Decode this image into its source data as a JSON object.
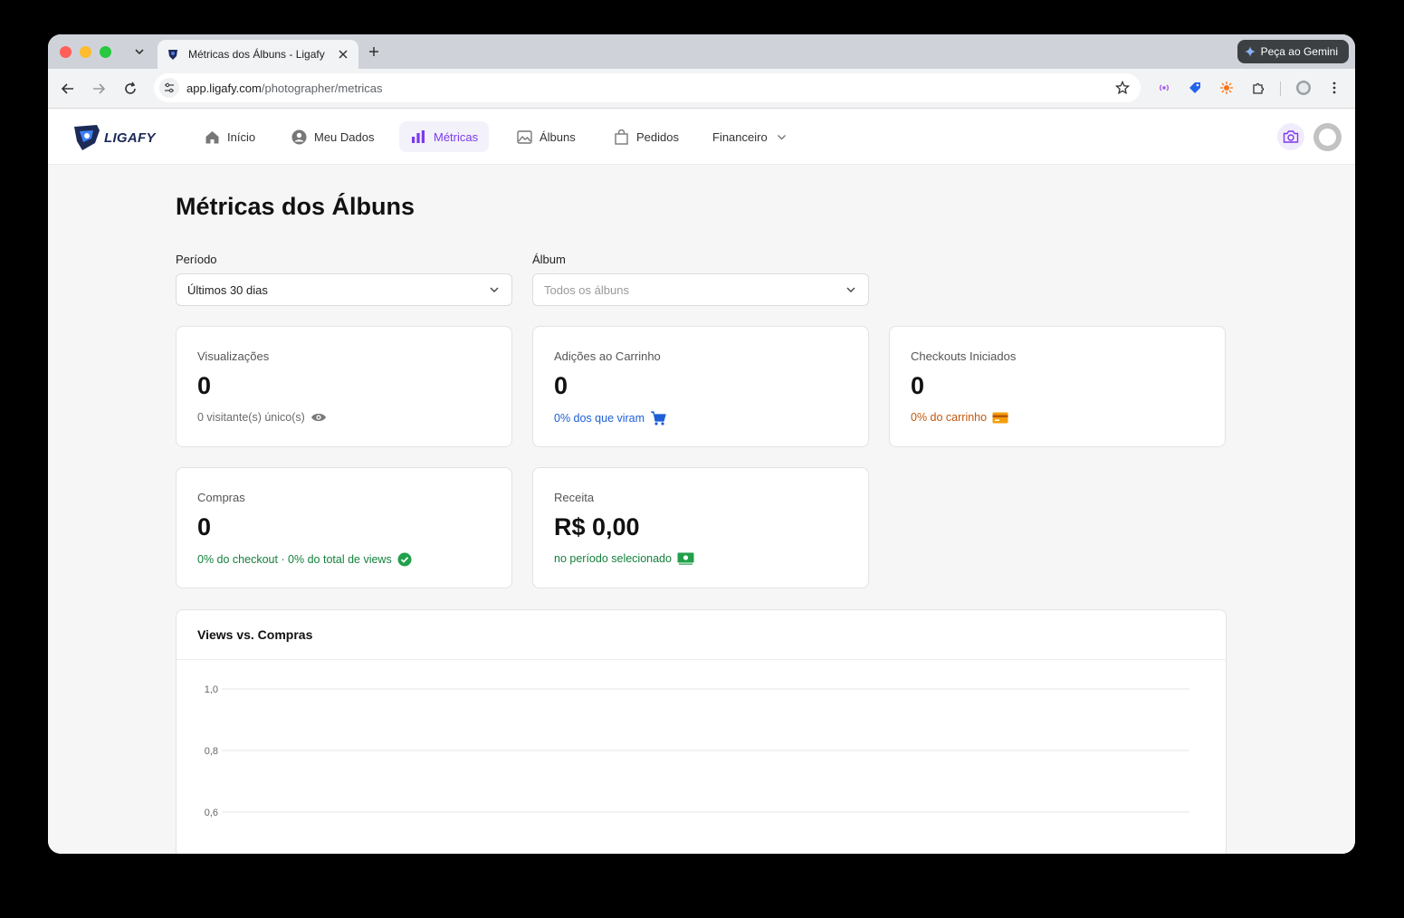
{
  "browser": {
    "tab_title": "Métricas dos Álbuns - Ligafy",
    "url_host": "app.ligafy.com",
    "url_path": "/photographer/metricas",
    "gemini_label": "Peça ao Gemini"
  },
  "app": {
    "logo_text": "LIGAFY",
    "nav": {
      "inicio": "Início",
      "meus_dados": "Meu Dados",
      "metricas": "Métricas",
      "albuns": "Álbuns",
      "pedidos": "Pedidos",
      "financeiro": "Financeiro"
    },
    "accent": "#7c3aed"
  },
  "page": {
    "title": "Métricas dos Álbuns",
    "filters": {
      "periodo_label": "Período",
      "periodo_value": "Últimos 30 dias",
      "album_label": "Álbum",
      "album_placeholder": "Todos os álbuns"
    },
    "cards": {
      "views": {
        "label": "Visualizações",
        "value": "0",
        "sub": "0 visitante(s) único(s)"
      },
      "cart": {
        "label": "Adições ao Carrinho",
        "value": "0",
        "sub": "0% dos que viram"
      },
      "checkouts": {
        "label": "Checkouts Iniciados",
        "value": "0",
        "sub": "0% do carrinho"
      },
      "purchases": {
        "label": "Compras",
        "value": "0",
        "sub": "0% do checkout · 0% do total de views"
      },
      "revenue": {
        "label": "Receita",
        "value": "R$ 0,00",
        "sub": "no período selecionado"
      }
    },
    "status_colors": {
      "muted": "#6b6b6b",
      "blue": "#1d5fd6",
      "orange": "#c2570c",
      "green": "#15803d"
    }
  },
  "chart_data": {
    "type": "line",
    "title": "Views vs. Compras",
    "y_ticks": [
      "1,0",
      "0,8",
      "0,6"
    ],
    "ylim": [
      0,
      1
    ],
    "series": [],
    "grid": true
  }
}
